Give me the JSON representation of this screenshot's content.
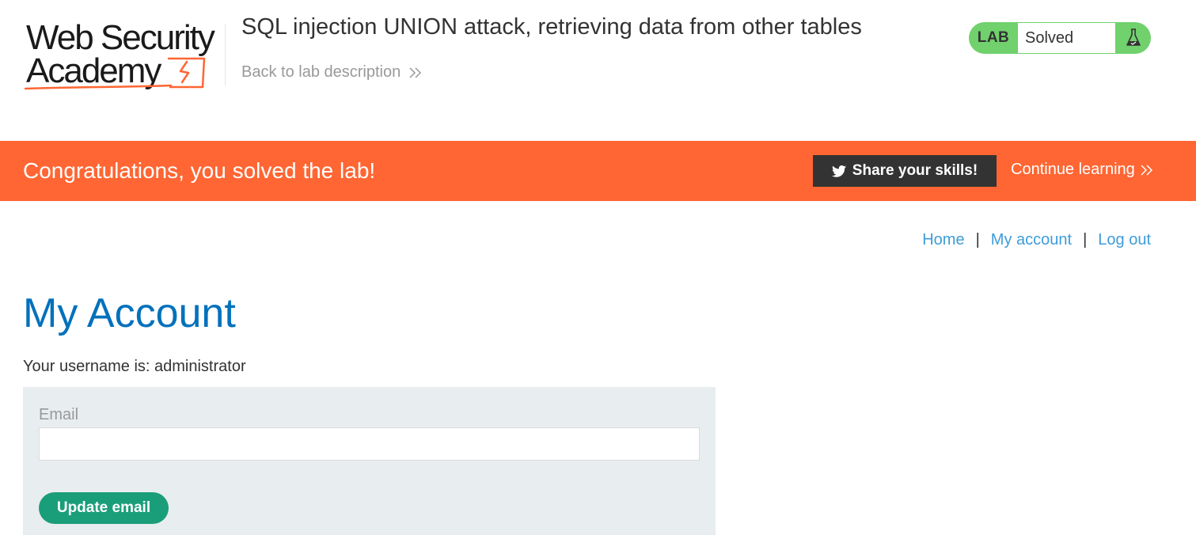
{
  "header": {
    "logo_line1": "Web Security",
    "logo_line2": "Academy",
    "lab_title": "SQL injection UNION attack, retrieving data from other tables",
    "back_link": "Back to lab description",
    "lab_badge": "LAB",
    "lab_status": "Solved"
  },
  "banner": {
    "message": "Congratulations, you solved the lab!",
    "share_label": "Share your skills!",
    "continue_label": "Continue learning"
  },
  "nav": {
    "home": "Home",
    "account": "My account",
    "logout": "Log out",
    "separator": "|"
  },
  "main": {
    "title": "My Account",
    "username_line": "Your username is: administrator",
    "email_label": "Email",
    "email_value": "",
    "update_label": "Update email"
  },
  "colors": {
    "banner": "#ff6633",
    "solved": "#70d16d",
    "link": "#3e9cd9",
    "title": "#0071bc",
    "button": "#1a9e7a"
  }
}
